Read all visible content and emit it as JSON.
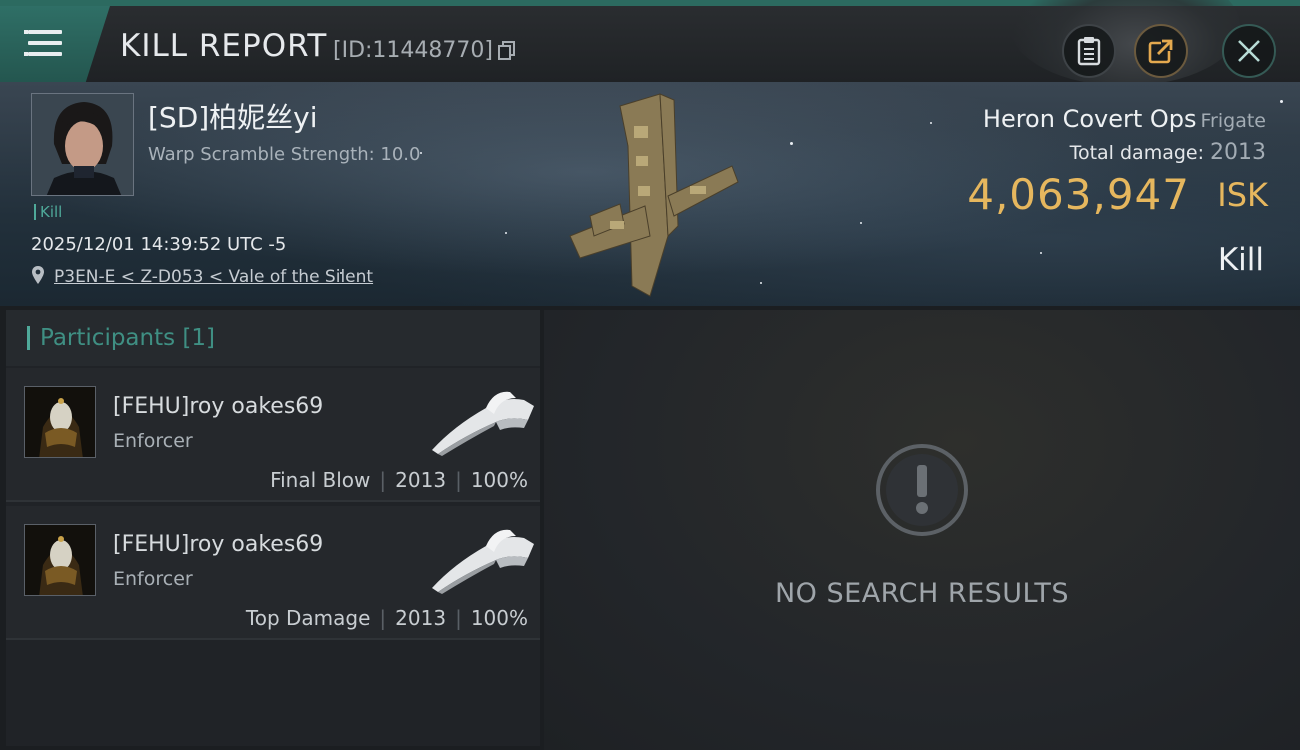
{
  "header": {
    "title": "KILL REPORT",
    "report_id": "[ID:11448770]"
  },
  "victim": {
    "name": "[SD]柏妮丝yi",
    "warp_scramble": "Warp Scramble Strength: 10.0",
    "tag": "Kill",
    "datetime": "2025/12/01 14:39:52 UTC -5",
    "location": "P3EN-E < Z-D053 < Vale of the Silent",
    "ship_name": "Heron Covert Ops",
    "ship_class": "Frigate",
    "total_damage_label": "Total damage:",
    "total_damage": "2013",
    "isk_value": "4,063,947",
    "isk_unit": "ISK",
    "result": "Kill"
  },
  "participants": {
    "title": "Participants [1]",
    "rows": [
      {
        "name": "[FEHU]roy oakes69",
        "role": "Enforcer",
        "label": "Final Blow",
        "damage": "2013",
        "percent": "100%"
      },
      {
        "name": "[FEHU]roy oakes69",
        "role": "Enforcer",
        "label": "Top Damage",
        "damage": "2013",
        "percent": "100%"
      }
    ]
  },
  "right_panel": {
    "empty_message": "NO SEARCH RESULTS"
  },
  "colors": {
    "accent": "#4fa99a",
    "isk": "#e6b75e",
    "header_tab": "#2f6f66"
  },
  "icons": [
    "menu-icon",
    "copy-icon",
    "clipboard-icon",
    "share-icon",
    "close-icon",
    "location-pin-icon",
    "exclamation-icon"
  ]
}
